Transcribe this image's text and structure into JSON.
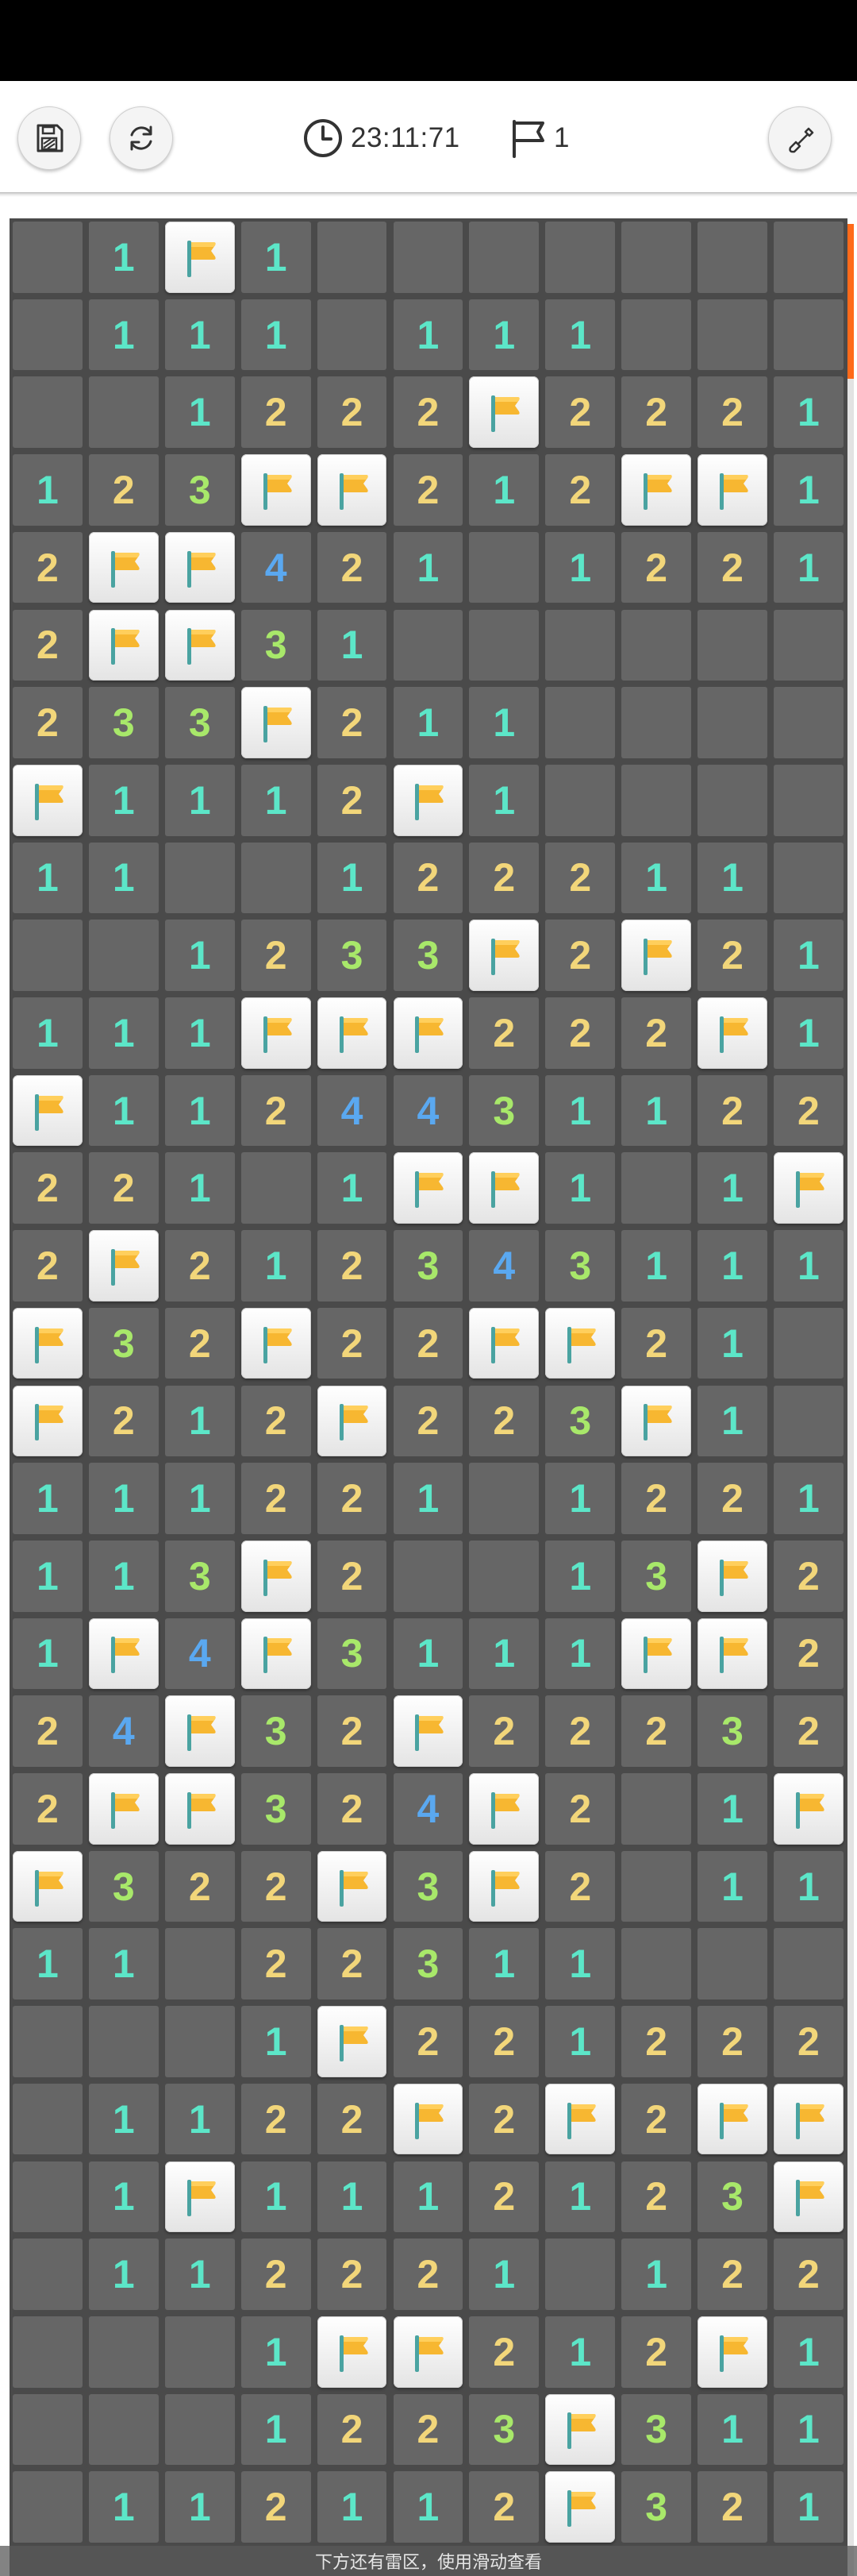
{
  "toolbar": {
    "timer": "23:11:71",
    "flags": "1",
    "icons": [
      "save-icon",
      "restart-icon",
      "clock-icon",
      "flag-outline-icon",
      "shovel-icon"
    ]
  },
  "board": {
    "columns": 11,
    "colors": {
      "1": "#5ce6c8",
      "2": "#f2d67a",
      "3": "#a8e86a",
      "4": "#5aa8f0",
      "unrevealed": "#666666",
      "flag": "#f7b731"
    },
    "rows": [
      [
        "",
        "1",
        "F",
        "1",
        "",
        "",
        "",
        "",
        "",
        "",
        ""
      ],
      [
        "",
        "1",
        "1",
        "1",
        "",
        "1",
        "1",
        "1",
        "",
        "",
        ""
      ],
      [
        "",
        "",
        "1",
        "2",
        "2",
        "2",
        "F",
        "2",
        "2",
        "2",
        "1"
      ],
      [
        "1",
        "2",
        "3",
        "F",
        "F",
        "2",
        "1",
        "2",
        "F",
        "F",
        "1"
      ],
      [
        "2",
        "F",
        "F",
        "4",
        "2",
        "1",
        "",
        "1",
        "2",
        "2",
        "1"
      ],
      [
        "2",
        "F",
        "F",
        "3",
        "1",
        "",
        "",
        "",
        "",
        "",
        ""
      ],
      [
        "2",
        "3",
        "3",
        "F",
        "2",
        "1",
        "1",
        "",
        "",
        "",
        ""
      ],
      [
        "F",
        "1",
        "1",
        "1",
        "2",
        "F",
        "1",
        "",
        "",
        "",
        ""
      ],
      [
        "1",
        "1",
        "",
        "",
        "1",
        "2",
        "2",
        "2",
        "1",
        "1",
        ""
      ],
      [
        "",
        "",
        "1",
        "2",
        "3",
        "3",
        "F",
        "2",
        "F",
        "2",
        "1"
      ],
      [
        "1",
        "1",
        "1",
        "F",
        "F",
        "F",
        "2",
        "2",
        "2",
        "F",
        "1"
      ],
      [
        "F",
        "1",
        "1",
        "2",
        "4",
        "4",
        "3",
        "1",
        "1",
        "2",
        "2"
      ],
      [
        "2",
        "2",
        "1",
        "",
        "1",
        "F",
        "F",
        "1",
        "",
        "1",
        "F"
      ],
      [
        "2",
        "F",
        "2",
        "1",
        "2",
        "3",
        "4",
        "3",
        "1",
        "1",
        "1"
      ],
      [
        "F",
        "3",
        "2",
        "F",
        "2",
        "2",
        "F",
        "F",
        "2",
        "1",
        ""
      ],
      [
        "F",
        "2",
        "1",
        "2",
        "F",
        "2",
        "2",
        "3",
        "F",
        "1",
        ""
      ],
      [
        "1",
        "1",
        "1",
        "2",
        "2",
        "1",
        "",
        "1",
        "2",
        "2",
        "1"
      ],
      [
        "1",
        "1",
        "3",
        "F",
        "2",
        "",
        "",
        "1",
        "3",
        "F",
        "2"
      ],
      [
        "1",
        "F",
        "4",
        "F",
        "3",
        "1",
        "1",
        "1",
        "F",
        "F",
        "2"
      ],
      [
        "2",
        "4",
        "F",
        "3",
        "2",
        "F",
        "2",
        "2",
        "2",
        "3",
        "2"
      ],
      [
        "2",
        "F",
        "F",
        "3",
        "2",
        "4",
        "F",
        "2",
        "",
        "1",
        "F"
      ],
      [
        "F",
        "3",
        "2",
        "2",
        "F",
        "3",
        "F",
        "2",
        "",
        "1",
        "1"
      ],
      [
        "1",
        "1",
        "",
        "2",
        "2",
        "3",
        "1",
        "1",
        "",
        "",
        ""
      ],
      [
        "",
        "",
        "",
        "1",
        "F",
        "2",
        "2",
        "1",
        "2",
        "2",
        "2"
      ],
      [
        "",
        "1",
        "1",
        "2",
        "2",
        "F",
        "2",
        "F",
        "2",
        "F",
        "F"
      ],
      [
        "",
        "1",
        "F",
        "1",
        "1",
        "1",
        "2",
        "1",
        "2",
        "3",
        "F"
      ],
      [
        "",
        "1",
        "1",
        "2",
        "2",
        "2",
        "1",
        "",
        "1",
        "2",
        "2"
      ],
      [
        "",
        "",
        "",
        "1",
        "F",
        "F",
        "2",
        "1",
        "2",
        "F",
        "1"
      ],
      [
        "",
        "",
        "",
        "1",
        "2",
        "2",
        "3",
        "F",
        "3",
        "1",
        "1"
      ],
      [
        "",
        "1",
        "1",
        "2",
        "1",
        "1",
        "2",
        "F",
        "3",
        "2",
        "1"
      ]
    ]
  },
  "hint": "下方还有雷区，使用滑动查看"
}
